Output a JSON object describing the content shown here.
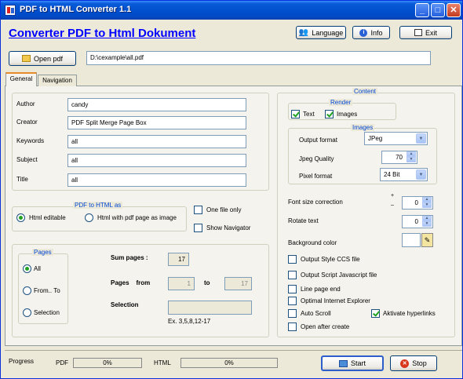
{
  "window": {
    "title": "PDF to HTML Converter 1.1"
  },
  "header": {
    "heading": "Converter PDF to  Html Dokument",
    "language_label": "Language",
    "info_label": "Info",
    "exit_label": "Exit"
  },
  "file": {
    "open_label": "Open pdf",
    "path": "D:\\cexample\\all.pdf"
  },
  "tabs": [
    "General",
    "Navigation"
  ],
  "meta": {
    "author_label": "Author",
    "author_value": "candy",
    "creator_label": "Creator",
    "creator_value": "PDF Split Merge Page Box",
    "keywords_label": "Keywords",
    "keywords_value": "all",
    "subject_label": "Subject",
    "subject_value": "all",
    "title_label": "Title",
    "title_value": "all"
  },
  "html_as": {
    "caption": "PDF to HTML as",
    "opt_editable": "Html editable",
    "opt_image": "Html with pdf page as image",
    "one_file": "One file only",
    "show_nav": "Show Navigator"
  },
  "pages": {
    "caption": "Pages",
    "opt_all": "All",
    "opt_from_to": "From.. To",
    "opt_selection": "Selection",
    "sum_label": "Sum pages :",
    "sum_value": "17",
    "from_label": "Pages    from",
    "from_value": "1",
    "to_label": "to",
    "to_value": "17",
    "selection_label": "Selection",
    "selection_hint": "Ex. 3,5,8,12-17"
  },
  "content": {
    "caption": "Content",
    "render_caption": "Render",
    "text_label": "Text",
    "images_label": "Images",
    "images_caption": "Images",
    "output_format_label": "Output format",
    "output_format_value": "JPeg",
    "jpeg_quality_label": "Jpeg Quality",
    "jpeg_quality_value": "70",
    "pixel_format_label": "Pixel format",
    "pixel_format_value": "24 Bit",
    "font_corr_label": "Font size correction",
    "font_corr_value": "0",
    "rotate_label": "Rotate text",
    "rotate_value": "0",
    "bg_label": "Background color",
    "opt_css": "Output Style CCS file",
    "opt_js": "Output Script Javascript file",
    "opt_line": "Line page end",
    "opt_ie": "Optimal Internet Explorer",
    "opt_autoscroll": "Auto Scroll",
    "opt_hyperlinks": "Aktivate hyperlinks",
    "opt_open": "Open after create"
  },
  "footer": {
    "progress_label": "Progress",
    "pdf_label": "PDF",
    "pdf_value": "0%",
    "html_label": "HTML",
    "html_value": "0%",
    "start_label": "Start",
    "stop_label": "Stop"
  },
  "colors": {
    "title_blue": "#0151d0",
    "heading_blue": "#0000ff",
    "accent_green": "#21a121"
  }
}
